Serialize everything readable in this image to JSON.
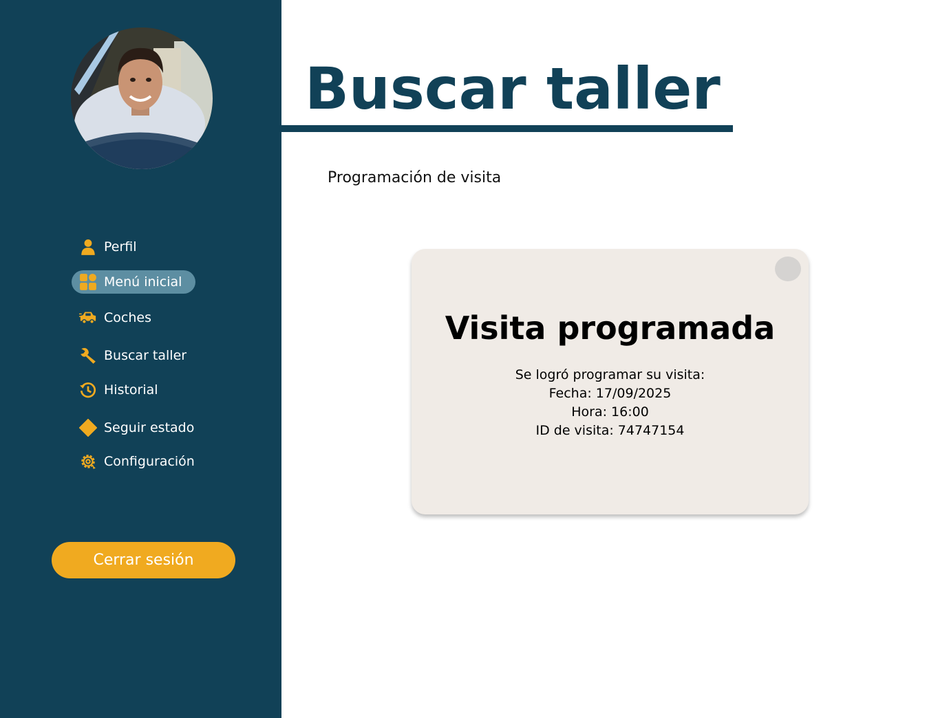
{
  "sidebar": {
    "avatar_alt": "Foto de perfil",
    "items": [
      {
        "label": "Perfil",
        "icon": "user-icon",
        "active": false
      },
      {
        "label": "Menú inicial",
        "icon": "grid-icon",
        "active": true
      },
      {
        "label": "Coches",
        "icon": "car-icon",
        "active": false
      },
      {
        "label": "Buscar taller",
        "icon": "wrench-icon",
        "active": false
      },
      {
        "label": "Historial",
        "icon": "history-icon",
        "active": false
      },
      {
        "label": "Seguir estado",
        "icon": "diamond-icon",
        "active": false
      },
      {
        "label": "Configuración",
        "icon": "gear-icon",
        "active": false
      }
    ],
    "logout_label": "Cerrar sesión"
  },
  "main": {
    "title": "Buscar taller",
    "section_label": "Programación de visita"
  },
  "modal": {
    "title": "Visita programada",
    "lines": [
      "Se logró programar su visita:",
      "Fecha: 17/09/2025",
      "Hora: 16:00",
      "ID de visita: 74747154"
    ]
  },
  "colors": {
    "sidebar_bg": "#114157",
    "accent": "#f0aa20",
    "active_item_bg": "#5d8ea2",
    "modal_bg": "#f0ebe6"
  }
}
